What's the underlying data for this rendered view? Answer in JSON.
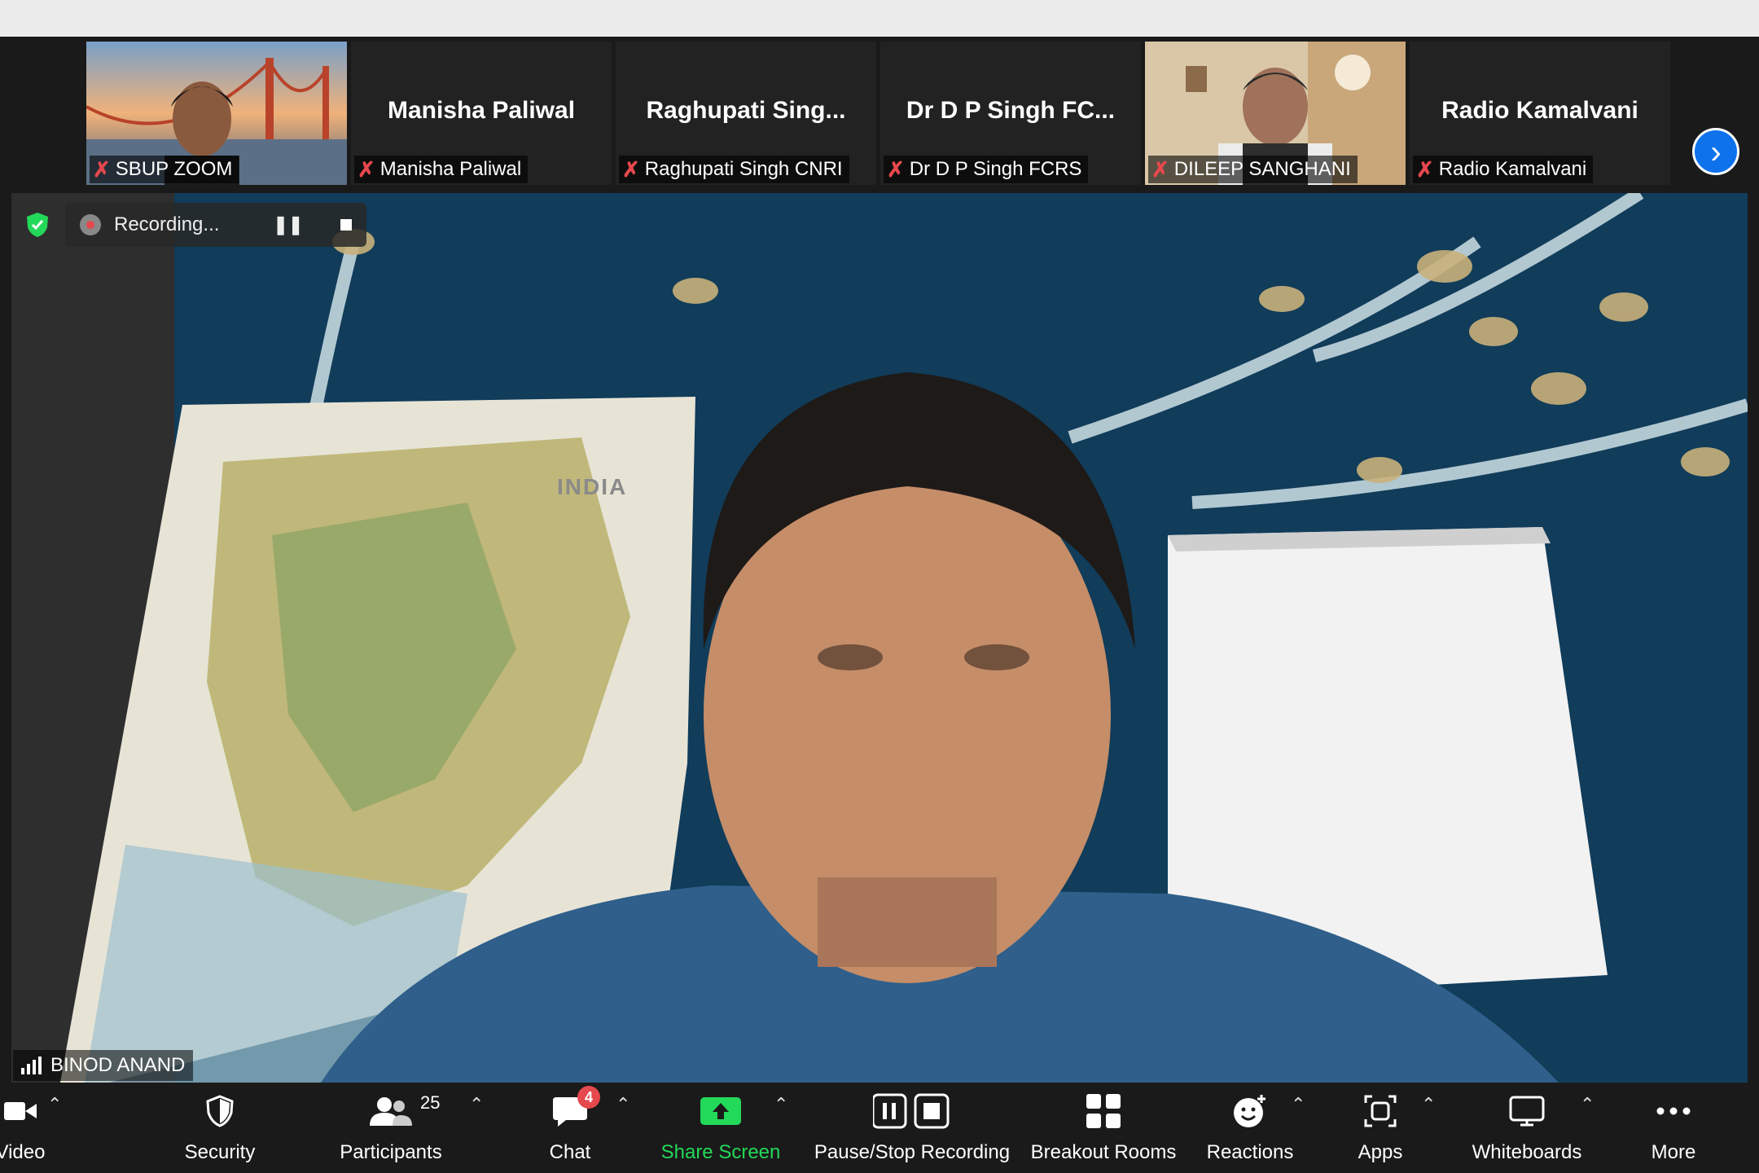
{
  "participants_strip": [
    {
      "name": "",
      "label": "SBUP ZOOM",
      "has_video": true
    },
    {
      "name": "Manisha Paliwal",
      "label": "Manisha Paliwal",
      "has_video": false
    },
    {
      "name": "Raghupati  Sing...",
      "label": "Raghupati Singh CNRI",
      "has_video": false
    },
    {
      "name": "Dr D P Singh FC...",
      "label": "Dr D P Singh FCRS",
      "has_video": false
    },
    {
      "name": "",
      "label": "DILEEP SANGHANI",
      "has_video": true
    },
    {
      "name": "Radio Kamalvani",
      "label": "Radio Kamalvani",
      "has_video": false
    }
  ],
  "recording": {
    "status": "Recording..."
  },
  "speaker": {
    "name": "BINOD ANAND",
    "map_label": "INDIA"
  },
  "toolbar": {
    "video_label": "Video",
    "security_label": "Security",
    "participants_label": "Participants",
    "participants_count": "25",
    "chat_label": "Chat",
    "chat_badge": "4",
    "share_label": "Share Screen",
    "recording_label": "Pause/Stop Recording",
    "breakout_label": "Breakout Rooms",
    "reactions_label": "Reactions",
    "apps_label": "Apps",
    "whiteboards_label": "Whiteboards",
    "more_label": "More"
  },
  "colors": {
    "share_green": "#23d959",
    "accent_blue": "#0e72ed",
    "mute_red": "#e5484d"
  }
}
